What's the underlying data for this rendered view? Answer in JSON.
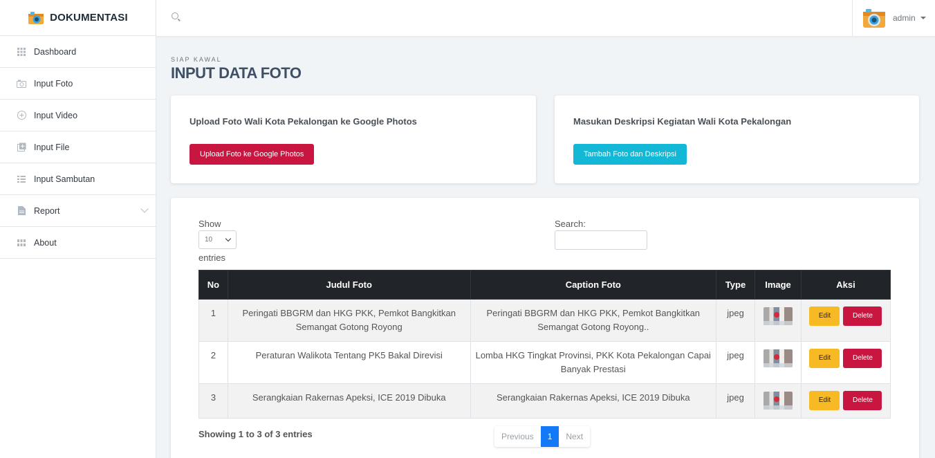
{
  "brand": {
    "name": "DOKUMENTASI"
  },
  "sidebar": {
    "items": [
      {
        "label": "Dashboard",
        "icon": "grid-icon"
      },
      {
        "label": "Input Foto",
        "icon": "camera-icon"
      },
      {
        "label": "Input Video",
        "icon": "plus-circle-icon"
      },
      {
        "label": "Input File",
        "icon": "file-add-icon"
      },
      {
        "label": "Input Sambutan",
        "icon": "grid-icon"
      },
      {
        "label": "Report",
        "icon": "document-icon"
      },
      {
        "label": "About",
        "icon": "grid-icon"
      }
    ]
  },
  "header": {
    "user": "admin"
  },
  "page": {
    "eyebrow": "SIAP KAWAL",
    "title": "INPUT DATA FOTO"
  },
  "cards": {
    "upload": {
      "title": "Upload Foto Wali Kota Pekalongan ke Google Photos",
      "button": "Upload Foto ke Google Photos"
    },
    "describe": {
      "title": "Masukan Deskripsi Kegiatan Wali Kota Pekalongan",
      "button": "Tambah Foto dan Deskripsi"
    }
  },
  "table": {
    "show_label": "Show",
    "page_size": "10",
    "entries_label": "entries",
    "search_label": "Search:",
    "headers": [
      "No",
      "Judul Foto",
      "Caption Foto",
      "Type",
      "Image",
      "Aksi"
    ],
    "rows": [
      {
        "no": "1",
        "judul": "Peringati BBGRM dan HKG PKK, Pemkot Bangkitkan Semangat Gotong Royong",
        "caption": "Peringati BBGRM dan HKG PKK, Pemkot Bangkitkan Semangat Gotong Royong..",
        "type": "jpeg"
      },
      {
        "no": "2",
        "judul": "Peraturan Walikota Tentang PK5 Bakal Direvisi",
        "caption": "Lomba HKG Tingkat Provinsi, PKK Kota Pekalongan Capai Banyak Prestasi",
        "type": "jpeg"
      },
      {
        "no": "3",
        "judul": "Serangkaian Rakernas Apeksi, ICE 2019 Dibuka",
        "caption": "Serangkaian Rakernas Apeksi, ICE 2019 Dibuka",
        "type": "jpeg"
      }
    ],
    "edit_label": "Edit",
    "delete_label": "Delete",
    "info": "Showing 1 to 3 of 3 entries",
    "pager": {
      "prev": "Previous",
      "current": "1",
      "next": "Next"
    }
  },
  "colors": {
    "primary_red": "#c91640",
    "cyan": "#12b8d6",
    "warning": "#f7b924",
    "active_page": "#1479f6",
    "table_head": "#212529"
  }
}
